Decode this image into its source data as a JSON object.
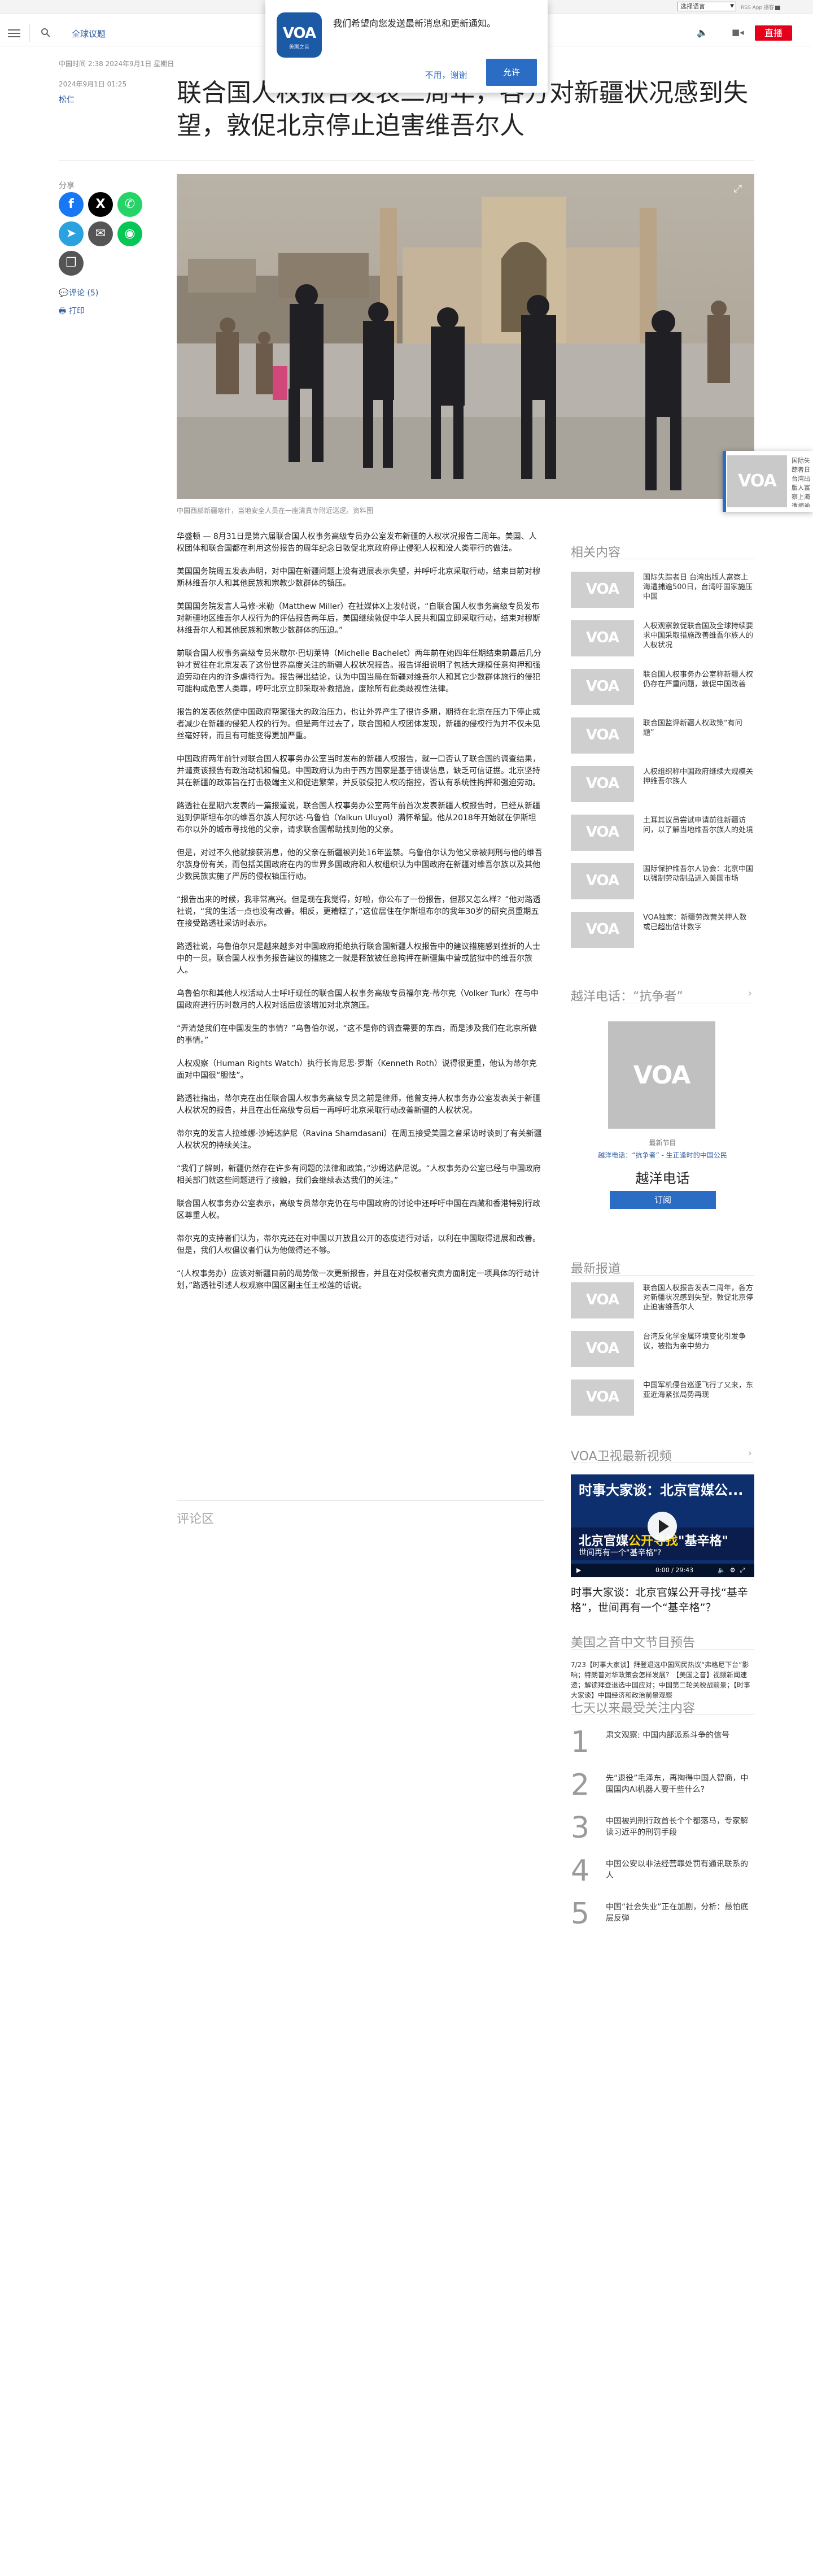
{
  "utility": {
    "language": "选择语言",
    "links": "RSS App 播客"
  },
  "nav": {
    "site_name": "全球议题",
    "live_label": "直播"
  },
  "push": {
    "logo_text": "VOA",
    "logo_sub": "美国之音",
    "message": "我们希望向您发送最新消息和更新通知。",
    "decline": "不用，谢谢",
    "accept": "允许"
  },
  "article": {
    "date_line": "中国时间 2:38 2024年9月1日 星期日",
    "date_line2": "2024年9月1日 01:25",
    "author": "松仁",
    "title": "联合国人权报告发表二周年，各方对新疆状况感到失望，敦促北京停止迫害维吾尔人",
    "caption": "中国西部新疆喀什，当地安全人员在一座清真寺附近巡逻。资料图",
    "comment_link": "评论 (5)",
    "print_link": "打印",
    "share_label": "分享",
    "paragraphs": [
      "华盛顿 — 8月31日是第六届联合国人权事务高级专员办公室发布新疆的人权状况报告二周年。美国、人权团体和联合国都在利用这份报告的周年纪念日敦促北京政府停止侵犯人权和没人类罪行的做法。",
      "美国国务院周五发表声明，对中国在新疆问题上没有进展表示失望，并呼吁北京采取行动，结束目前对穆斯林维吾尔人和其他民族和宗教少数群体的镇压。",
      "美国国务院发言人马修·米勒（Matthew Miller）在社媒体X上发帖说，“自联合国人权事务高级专员发布对新疆地区维吾尔人权行为的评估报告两年后，美国继续敦促中华人民共和国立即采取行动，结束对穆斯林维吾尔人和其他民族和宗教少数群体的压迫。”",
      "前联合国人权事务高级专员米歇尔·巴切莱特（Michelle Bachelet）两年前在她四年任期结束前最后几分钟才贸往在北京发表了这份世界高度关注的新疆人权状况报告。报告详细说明了包括大规模任意拘押和强迫劳动在内的许多虐待行为。报告得出结论，认为中国当局在新疆对维吾尔人和其它少数群体施行的侵犯可能构成危害人类罪，呼吁北京立即采取补救措施，废除所有此类歧视性法律。",
      "报告的发表依然使中国政府帮案强大的政治压力，也让外界产生了很许多期，期待在北京在压力下停止或者减少在新疆的侵犯人权的行为。但是两年过去了，联合国和人权团体发现，新疆的侵权行为并不仅未见丝毫好转，而且有可能变得更加严重。",
      "中国政府两年前针对联合国人权事务办公室当时发布的新疆人权报告，就一口否认了联合国的调查结果，并谴责该报告有政治动机和偏见。中国政府认为由于西方国家是基于错误信息，缺乏可信证据。北京坚持其在新疆的政策旨在打击极端主义和促进繁荣，并反驳侵犯人权的指控，否认有系统性拘押和强迫劳动。",
      "路透社在星期六发表的一篇报道说，联合国人权事务办公室两年前首次发表新疆人权报告时，已经从新疆逃到伊斯坦布尔的维吾尔族人阿尔达·乌鲁伯（Yalkun Uluyol）满怀希望。他从2018年开始就在伊斯坦布尔以外的城市寻找他的父亲，请求联合国帮助找到他的父亲。",
      "但是，对过不久他就接获消息，他的父亲在新疆被判处16年监禁。乌鲁伯尔认为他父亲被判刑与他的维吾尔族身份有关，而包括美国政府在内的世界多国政府和人权组织认为中国政府在新疆对维吾尔族以及其他少数民族实施了严厉的侵权镇压行动。",
      "“报告出来的时候，我非常高兴。但是现在我觉得，好啦，你公布了一份报告，但那又怎么样？”他对路透社说，“我的生活一点也没有改善。相反，更糟糕了，”这位居住在伊斯坦布尔的我年30岁的研究员重期五在接受路透社采访时表示。",
      "路透社说，乌鲁伯尔只是越来越多对中国政府拒绝执行联合国新疆人权报告中的建议措施感到挫折的人士中的一员。联合国人权事务报告建议的措施之一就是释放被任意拘押在新疆集中营或监狱中的维吾尔族人。",
      "乌鲁伯尔和其他人权活动人士呼吁现任的联合国人权事务高级专员福尔克·蒂尔克（Volker Turk）在与中国政府进行历时数月的人权对话后应该增加对北京施压。",
      "“弄清楚我们在中国发生的事情？”乌鲁伯尔说，“这不是你的调查需要的东西，而是涉及我们在北京所做的事情。”",
      "人权观察（Human Rights Watch）执行长肯尼思·罗斯（Kenneth Roth）说得很更重，他认为蒂尔克面对中国很“胆怯”。",
      "路透社指出，蒂尔克在出任联合国人权事务高级专员之前是律师，他曾支持人权事务办公室发表关于新疆人权状况的报告，并且在出任高级专员后一再呼吁北京采取行动改善新疆的人权状况。",
      "蒂尔克的发言人拉维娜·沙姆达萨尼（Ravina Shamdasani）在周五接受美国之音采访时谈到了有关新疆人权状况的持续关注。",
      "“我们了解到，新疆仍然存在许多有问题的法律和政策，”沙姆达萨尼说。“人权事务办公室已经与中国政府相关部门就这些问题进行了接触，我们会继续表达我们的关注。”",
      "联合国人权事务办公室表示，高级专员蒂尔克仍在与中国政府的讨论中还呼吁中国在西藏和香港特别行政区尊重人权。",
      "蒂尔克的支持者们认为，蒂尔克还在对中国以开放且公开的态度进行对话，以利在中国取得进展和改善。但是，我们人权倡议者们认为他做得还不够。",
      "“(人权事务办）应该对新疆目前的局势做一次更新报告，并且在对侵权者究责方面制定一项具体的行动计划，”路透社引述人权观察中国区副主任王松莲的话说。"
    ],
    "comments_heading": "评论区"
  },
  "sidebar": {
    "related_heading": "相关内容",
    "related": [
      "国际失踪者日 台湾出版人富察上海遭捕逾500日，台湾吁国家施压中国",
      "人权观察敦促联合国及全球持续要求中国采取措施改善维吾尔族人的人权状况",
      "联合国人权事务办公室称新疆人权仍存在严重问题，敦促中国改善",
      "联合国监评新疆人权政策“有问题”",
      "人权组织称中国政府继续大规模关押维吾尔族人",
      "土耳其议员尝试申请前往新疆访问，以了解当地维吾尔族人的处境",
      "国际保护维吾尔人协会：北京中国以强制劳动制品进入美国市场",
      "VOA独家：新疆劳改营关押人数或已超出估计数字"
    ],
    "podcast_heading": "越洋电话：“抗争者”",
    "podcast_label": "最新节目",
    "podcast_link": "越洋电话：“抗争者” - 生正逢时的中国公民",
    "podcast_title": "越洋电话",
    "subscribe": "订阅",
    "latest_heading": "最新报道",
    "latest": [
      "联合国人权报告发表二周年，各方对新疆状况感到失望，敦促北京停止迫害维吾尔人",
      "台湾反化学金属环境变化引发争议，被指为亲中势力",
      "中国军机侵台巡逻飞行了又来，东亚近海紧张局势再现"
    ],
    "video_heading": "VOA卫视最新视频",
    "video": {
      "top_text": "时事大家谈：北京官媒公...",
      "line1_a": "北京官媒",
      "line1_b": "公开寻找",
      "line1_c": "\"基辛格\"",
      "line2": "世间再有一个\"基辛格\"?",
      "time": "0:00 / 29:43",
      "caption": "时事大家谈：北京官媒公开寻找“基辛格”，世间再有一个“基辛格”？"
    },
    "schedule_heading": "美国之音中文节目预告",
    "schedule_text": "7/23【时事大家谈】拜登退选中国网民热议“弗格尼下台”影响；特朗普对华政策会怎样发展？【美国之音】视频新闻速递；解读拜登退选中国应对；中国第二轮关税战前景；【时事大家谈】中国经济和政治前景观察",
    "popular_heading": "七天以来最受关注内容",
    "popular": [
      "肃文观察: 中国内部派系斗争的信号",
      "先“退役”毛泽东，再掏得中国人智商，中国国内AI机器人要干些什么?",
      "中国被判刑行政首长个个都落马，专家解读习近平的刑罚手段",
      "中国公安以非法经营罪处罚有通讯联系的人",
      "中国“社会失业”正在加剧，分析：最怕底层反弹"
    ]
  },
  "colors": {
    "brand_blue": "#2c5aa0",
    "live_red": "#e4001b",
    "voa_blue": "#1d5aa6"
  }
}
